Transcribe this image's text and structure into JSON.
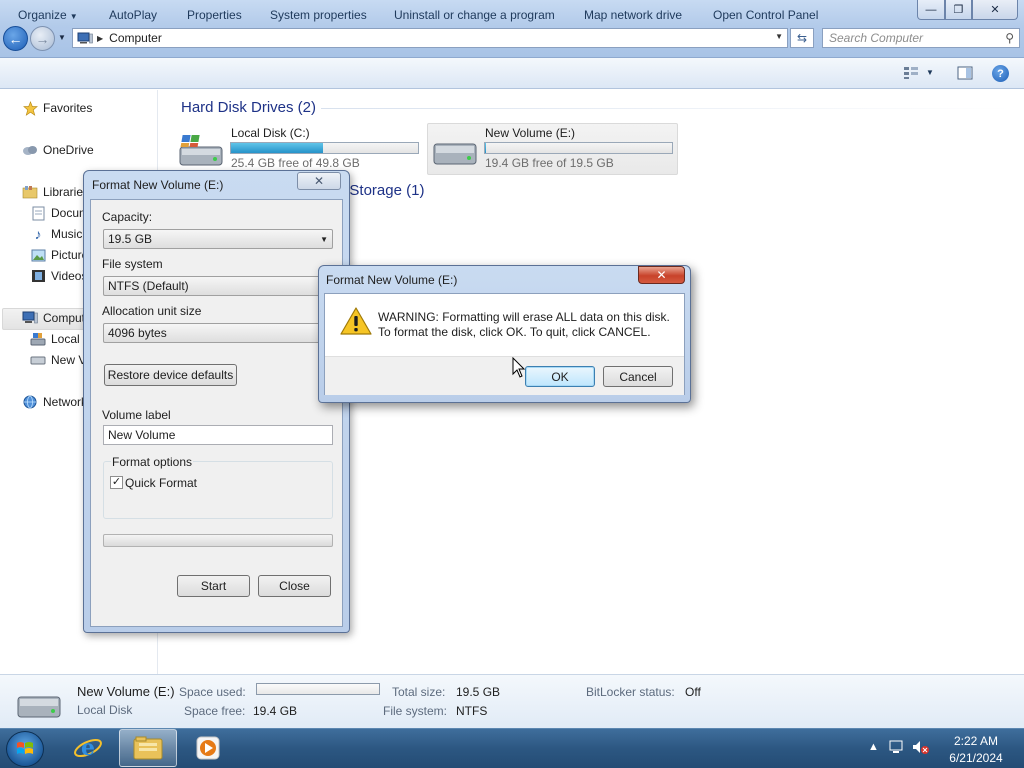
{
  "window": {
    "breadcrumb": "Computer",
    "search_placeholder": "Search Computer",
    "caption_minimize": "—",
    "caption_maximize": "❐",
    "caption_close": "✕"
  },
  "toolbar": {
    "organize": "Organize",
    "autoplay": "AutoPlay",
    "properties": "Properties",
    "system_properties": "System properties",
    "uninstall": "Uninstall or change a program",
    "map_drive": "Map network drive",
    "control_panel": "Open Control Panel"
  },
  "nav": {
    "favorites": "Favorites",
    "onedrive": "OneDrive",
    "libraries": "Libraries",
    "documents": "Documents",
    "music": "Music",
    "pictures": "Pictures",
    "videos": "Videos",
    "computer": "Computer",
    "local_disk": "Local Disk (C:)",
    "new_volume": "New Volume (E:)",
    "network": "Network"
  },
  "content": {
    "hdd_group": "Hard Disk Drives (2)",
    "removable_group": "Devices with Removable Storage (1)",
    "drives": [
      {
        "name": "Local Disk (C:)",
        "free": "25.4 GB free of 49.8 GB",
        "used_fraction": 0.49
      },
      {
        "name": "New Volume (E:)",
        "free": "19.4 GB free of 19.5 GB",
        "used_fraction": 0.005
      }
    ]
  },
  "details": {
    "name": "New Volume (E:)",
    "type": "Local Disk",
    "space_used_label": "Space used:",
    "space_free_label": "Space free:",
    "space_free": "19.4 GB",
    "total_size_label": "Total size:",
    "total_size": "19.5 GB",
    "filesystem_label": "File system:",
    "filesystem": "NTFS",
    "bitlocker_label": "BitLocker status:",
    "bitlocker": "Off"
  },
  "format_dialog": {
    "title": "Format New Volume (E:)",
    "close": "✕",
    "capacity_label": "Capacity:",
    "capacity": "19.5 GB",
    "filesystem_label": "File system",
    "filesystem": "NTFS (Default)",
    "allocation_label": "Allocation unit size",
    "allocation": "4096 bytes",
    "restore_button": "Restore device defaults",
    "volume_label_label": "Volume label",
    "volume_label": "New Volume",
    "options_label": "Format options",
    "quick_format": "Quick Format",
    "quick_format_checked": "✓",
    "start_button": "Start",
    "close_button": "Close"
  },
  "warning_dialog": {
    "title": "Format New Volume (E:)",
    "close": "✕",
    "line1": "WARNING: Formatting will erase ALL data on this disk.",
    "line2": "To format the disk, click OK. To quit, click CANCEL.",
    "ok": "OK",
    "cancel": "Cancel"
  },
  "taskbar": {
    "time": "2:22 AM",
    "date": "6/21/2024"
  },
  "colors": {
    "accent": "#2693c9",
    "group_title": "#1e3287",
    "taskbar": "#2c5782"
  }
}
